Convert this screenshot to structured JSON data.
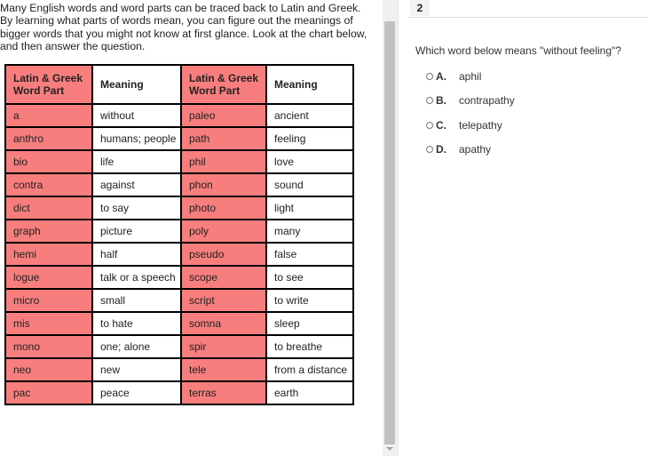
{
  "intro": "Many English words and word parts can be traced back to Latin and Greek. By learning what parts of words mean, you can figure out the meanings of bigger words that you might not know at first glance. Look at the chart below, and then answer the question.",
  "table": {
    "headers": [
      "Latin & Greek Word Part",
      "Meaning",
      "Latin & Greek Word Part",
      "Meaning"
    ],
    "rows": [
      [
        "a",
        "without",
        "paleo",
        "ancient"
      ],
      [
        "anthro",
        "humans; people",
        "path",
        "feeling"
      ],
      [
        "bio",
        "life",
        "phil",
        "love"
      ],
      [
        "contra",
        "against",
        "phon",
        "sound"
      ],
      [
        "dict",
        "to say",
        "photo",
        "light"
      ],
      [
        "graph",
        "picture",
        "poly",
        "many"
      ],
      [
        "hemi",
        "half",
        "pseudo",
        "false"
      ],
      [
        "logue",
        "talk or a speech",
        "scope",
        "to see"
      ],
      [
        "micro",
        "small",
        "script",
        "to write"
      ],
      [
        "mis",
        "to hate",
        "somna",
        "sleep"
      ],
      [
        "mono",
        "one; alone",
        "spir",
        "to breathe"
      ],
      [
        "neo",
        "new",
        "tele",
        "from a distance"
      ],
      [
        "pac",
        "peace",
        "terras",
        "earth"
      ]
    ]
  },
  "question": {
    "number": "2",
    "text": "Which word below means \"without feeling\"?",
    "options": [
      {
        "letter": "A.",
        "text": "aphil"
      },
      {
        "letter": "B.",
        "text": "contrapathy"
      },
      {
        "letter": "C.",
        "text": "telepathy"
      },
      {
        "letter": "D.",
        "text": "apathy"
      }
    ]
  },
  "colors": {
    "word_part_cell": "#f87e7e"
  }
}
